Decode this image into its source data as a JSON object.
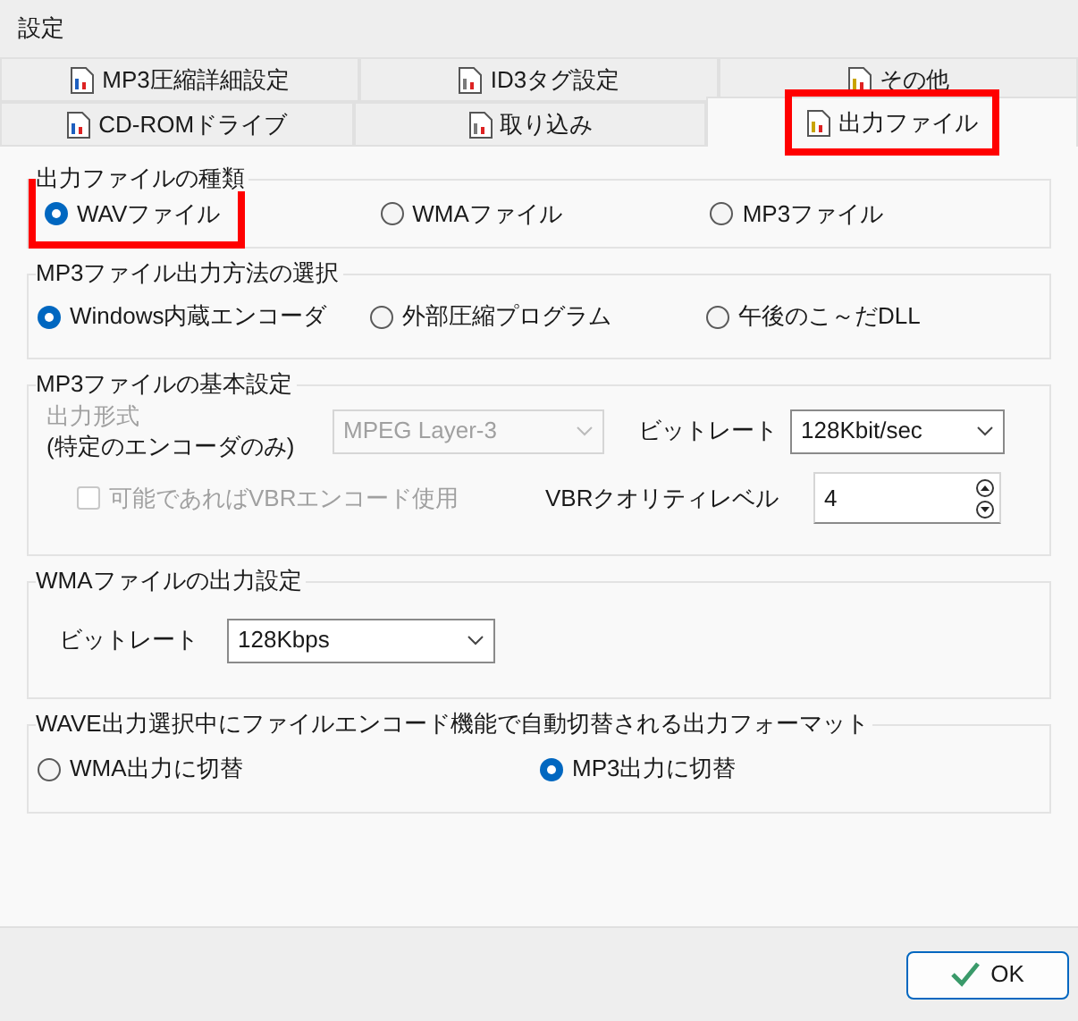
{
  "window": {
    "title": "設定"
  },
  "tab_rows": [
    [
      {
        "label": "MP3圧縮詳細設定",
        "selected": false,
        "highlighted": false
      },
      {
        "label": "ID3タグ設定",
        "selected": false,
        "highlighted": false
      },
      {
        "label": "その他",
        "selected": false,
        "highlighted": false
      }
    ],
    [
      {
        "label": "CD-ROMドライブ",
        "selected": false,
        "highlighted": false
      },
      {
        "label": "取り込み",
        "selected": false,
        "highlighted": false
      },
      {
        "label": "出力ファイル",
        "selected": true,
        "highlighted": true
      }
    ]
  ],
  "output_type": {
    "title": "出力ファイルの種類",
    "options": [
      {
        "label": "WAVファイル",
        "selected": true,
        "highlighted": true
      },
      {
        "label": "WMAファイル",
        "selected": false,
        "highlighted": false
      },
      {
        "label": "MP3ファイル",
        "selected": false,
        "highlighted": false
      }
    ]
  },
  "mp3_method": {
    "title": "MP3ファイル出力方法の選択",
    "options": [
      {
        "label": "Windows内蔵エンコーダ",
        "selected": true,
        "highlighted": false
      },
      {
        "label": "外部圧縮プログラム",
        "selected": false,
        "highlighted": false
      },
      {
        "label": "午後のこ～だDLL",
        "selected": false,
        "highlighted": false
      }
    ]
  },
  "mp3_basic": {
    "title": "MP3ファイルの基本設定",
    "format": {
      "label": "出力形式",
      "note": "(特定のエンコーダのみ)",
      "value": "MPEG Layer-3",
      "disabled": true
    },
    "bitrate": {
      "label": "ビットレート",
      "value": "128Kbit/sec"
    },
    "vbr_checkbox": {
      "label": "可能であればVBRエンコード使用",
      "checked": false,
      "disabled": true
    },
    "vbr_quality": {
      "label": "VBRクオリティレベル",
      "value": "4"
    }
  },
  "wma": {
    "title": "WMAファイルの出力設定",
    "bitrate": {
      "label": "ビットレート",
      "value": "128Kbps"
    }
  },
  "wave_switch": {
    "title": "WAVE出力選択中にファイルエンコード機能で自動切替される出力フォーマット",
    "options": [
      {
        "label": "WMA出力に切替",
        "selected": false,
        "highlighted": false
      },
      {
        "label": "MP3出力に切替",
        "selected": true,
        "highlighted": false
      }
    ]
  },
  "buttons": [
    {
      "label": "OK"
    }
  ]
}
